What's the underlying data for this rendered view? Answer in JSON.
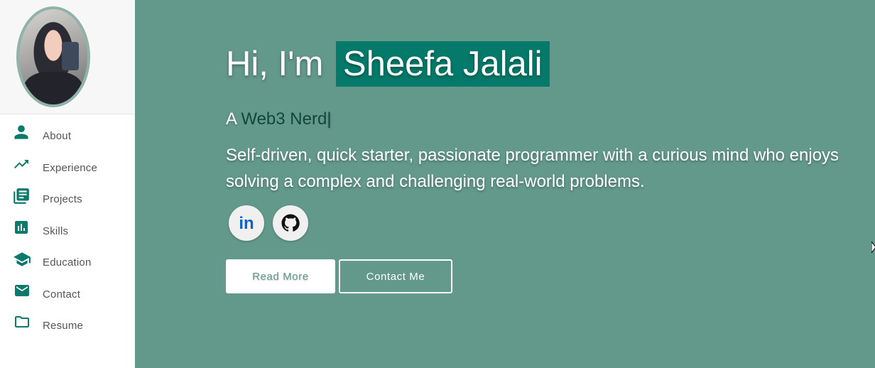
{
  "sidebar": {
    "items": [
      {
        "label": "About",
        "icon": "person-icon"
      },
      {
        "label": "Experience",
        "icon": "trending-up-icon"
      },
      {
        "label": "Projects",
        "icon": "library-books-icon"
      },
      {
        "label": "Skills",
        "icon": "bar-chart-icon"
      },
      {
        "label": "Education",
        "icon": "graduation-cap-icon"
      },
      {
        "label": "Contact",
        "icon": "mail-icon"
      },
      {
        "label": "Resume",
        "icon": "folder-icon"
      }
    ]
  },
  "hero": {
    "greeting_prefix": "Hi, I'm",
    "name": "Sheefa Jalali",
    "tagline_prefix": "A",
    "tagline_typed": "Web3 Nerd",
    "tagline_cursor": "|",
    "bio": "Self-driven, quick starter, passionate programmer with a curious mind who enjoys solving a complex and challenging real-world problems.",
    "social": [
      {
        "label": "in",
        "icon": "linkedin-icon"
      },
      {
        "icon": "github-icon"
      }
    ],
    "buttons": {
      "read_more": "Read More",
      "contact_me": "Contact Me"
    }
  },
  "colors": {
    "accent": "#057a6a",
    "main_bg": "#63998b",
    "icon": "#0b7a6c"
  }
}
